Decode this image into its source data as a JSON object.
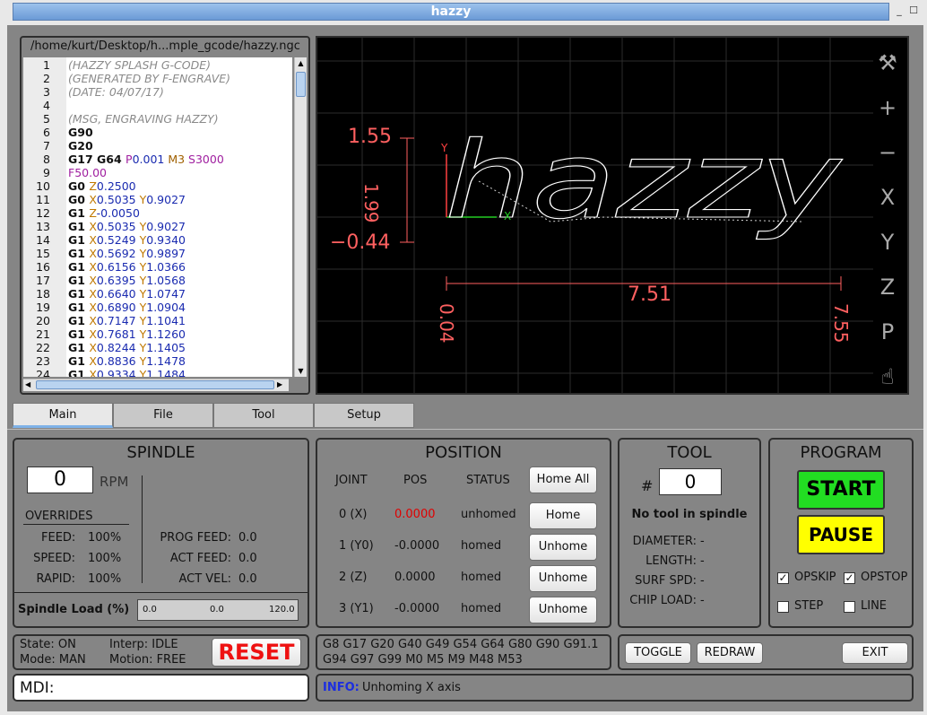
{
  "window": {
    "title": "hazzy"
  },
  "editor": {
    "path": "/home/kurt/Desktop/h...mple_gcode/hazzy.ngc",
    "lines": [
      {
        "n": "1",
        "segs": [
          {
            "t": "(HAZZY SPLASH G-CODE)",
            "c": "c-com"
          }
        ]
      },
      {
        "n": "2",
        "segs": [
          {
            "t": "(GENERATED BY F-ENGRAVE)",
            "c": "c-com"
          }
        ]
      },
      {
        "n": "3",
        "segs": [
          {
            "t": "(DATE: 04/07/17)",
            "c": "c-com"
          }
        ]
      },
      {
        "n": "4",
        "segs": []
      },
      {
        "n": "5",
        "segs": [
          {
            "t": "(MSG, ENGRAVING HAZZY)",
            "c": "c-com"
          }
        ]
      },
      {
        "n": "6",
        "segs": [
          {
            "t": "G90",
            "c": "c-g"
          }
        ]
      },
      {
        "n": "7",
        "segs": [
          {
            "t": "G20",
            "c": "c-g"
          }
        ]
      },
      {
        "n": "8",
        "segs": [
          {
            "t": "G17 G64 ",
            "c": "c-g"
          },
          {
            "t": "P",
            "c": "c-p"
          },
          {
            "t": "0.001 ",
            "c": "c-val"
          },
          {
            "t": "M3 ",
            "c": "c-m"
          },
          {
            "t": "S3000",
            "c": "c-p"
          }
        ]
      },
      {
        "n": "9",
        "segs": [
          {
            "t": "F50.00",
            "c": "c-p"
          }
        ]
      },
      {
        "n": "10",
        "segs": [
          {
            "t": "G0 ",
            "c": "c-g"
          },
          {
            "t": "Z",
            "c": "c-x"
          },
          {
            "t": "0.2500",
            "c": "c-val"
          }
        ]
      },
      {
        "n": "11",
        "segs": [
          {
            "t": "G0 ",
            "c": "c-g"
          },
          {
            "t": "X",
            "c": "c-x"
          },
          {
            "t": "0.5035 ",
            "c": "c-val"
          },
          {
            "t": "Y",
            "c": "c-x"
          },
          {
            "t": "0.9027",
            "c": "c-val"
          }
        ]
      },
      {
        "n": "12",
        "segs": [
          {
            "t": "G1 ",
            "c": "c-g"
          },
          {
            "t": "Z",
            "c": "c-x"
          },
          {
            "t": "-0.0050",
            "c": "c-val"
          }
        ]
      },
      {
        "n": "13",
        "segs": [
          {
            "t": "G1 ",
            "c": "c-g"
          },
          {
            "t": "X",
            "c": "c-x"
          },
          {
            "t": "0.5035 ",
            "c": "c-val"
          },
          {
            "t": "Y",
            "c": "c-x"
          },
          {
            "t": "0.9027",
            "c": "c-val"
          }
        ]
      },
      {
        "n": "14",
        "segs": [
          {
            "t": "G1 ",
            "c": "c-g"
          },
          {
            "t": "X",
            "c": "c-x"
          },
          {
            "t": "0.5249 ",
            "c": "c-val"
          },
          {
            "t": "Y",
            "c": "c-x"
          },
          {
            "t": "0.9340",
            "c": "c-val"
          }
        ]
      },
      {
        "n": "15",
        "segs": [
          {
            "t": "G1 ",
            "c": "c-g"
          },
          {
            "t": "X",
            "c": "c-x"
          },
          {
            "t": "0.5692 ",
            "c": "c-val"
          },
          {
            "t": "Y",
            "c": "c-x"
          },
          {
            "t": "0.9897",
            "c": "c-val"
          }
        ]
      },
      {
        "n": "16",
        "segs": [
          {
            "t": "G1 ",
            "c": "c-g"
          },
          {
            "t": "X",
            "c": "c-x"
          },
          {
            "t": "0.6156 ",
            "c": "c-val"
          },
          {
            "t": "Y",
            "c": "c-x"
          },
          {
            "t": "1.0366",
            "c": "c-val"
          }
        ]
      },
      {
        "n": "17",
        "segs": [
          {
            "t": "G1 ",
            "c": "c-g"
          },
          {
            "t": "X",
            "c": "c-x"
          },
          {
            "t": "0.6395 ",
            "c": "c-val"
          },
          {
            "t": "Y",
            "c": "c-x"
          },
          {
            "t": "1.0568",
            "c": "c-val"
          }
        ]
      },
      {
        "n": "18",
        "segs": [
          {
            "t": "G1 ",
            "c": "c-g"
          },
          {
            "t": "X",
            "c": "c-x"
          },
          {
            "t": "0.6640 ",
            "c": "c-val"
          },
          {
            "t": "Y",
            "c": "c-x"
          },
          {
            "t": "1.0747",
            "c": "c-val"
          }
        ]
      },
      {
        "n": "19",
        "segs": [
          {
            "t": "G1 ",
            "c": "c-g"
          },
          {
            "t": "X",
            "c": "c-x"
          },
          {
            "t": "0.6890 ",
            "c": "c-val"
          },
          {
            "t": "Y",
            "c": "c-x"
          },
          {
            "t": "1.0904",
            "c": "c-val"
          }
        ]
      },
      {
        "n": "20",
        "segs": [
          {
            "t": "G1 ",
            "c": "c-g"
          },
          {
            "t": "X",
            "c": "c-x"
          },
          {
            "t": "0.7147 ",
            "c": "c-val"
          },
          {
            "t": "Y",
            "c": "c-x"
          },
          {
            "t": "1.1041",
            "c": "c-val"
          }
        ]
      },
      {
        "n": "21",
        "segs": [
          {
            "t": "G1 ",
            "c": "c-g"
          },
          {
            "t": "X",
            "c": "c-x"
          },
          {
            "t": "0.7681 ",
            "c": "c-val"
          },
          {
            "t": "Y",
            "c": "c-x"
          },
          {
            "t": "1.1260",
            "c": "c-val"
          }
        ]
      },
      {
        "n": "22",
        "segs": [
          {
            "t": "G1 ",
            "c": "c-g"
          },
          {
            "t": "X",
            "c": "c-x"
          },
          {
            "t": "0.8244 ",
            "c": "c-val"
          },
          {
            "t": "Y",
            "c": "c-x"
          },
          {
            "t": "1.1405",
            "c": "c-val"
          }
        ]
      },
      {
        "n": "23",
        "segs": [
          {
            "t": "G1 ",
            "c": "c-g"
          },
          {
            "t": "X",
            "c": "c-x"
          },
          {
            "t": "0.8836 ",
            "c": "c-val"
          },
          {
            "t": "Y",
            "c": "c-x"
          },
          {
            "t": "1.1478",
            "c": "c-val"
          }
        ]
      },
      {
        "n": "24",
        "segs": [
          {
            "t": "G1 ",
            "c": "c-g"
          },
          {
            "t": "X",
            "c": "c-x"
          },
          {
            "t": "0.9334 ",
            "c": "c-val"
          },
          {
            "t": "Y",
            "c": "c-x"
          },
          {
            "t": "1.1484",
            "c": "c-val"
          }
        ]
      }
    ]
  },
  "preview": {
    "text": "hazzy",
    "dims": {
      "y_top": "1.55",
      "y_height": "1.99",
      "y_bottom": "−0.44",
      "x_width": "7.51",
      "x_left": "0.04",
      "x_right": "7.55"
    },
    "axis_x": "X",
    "axis_y": "Y",
    "tools": [
      {
        "name": "settings-tools-icon",
        "glyph": "⚒"
      },
      {
        "name": "zoom-in-icon",
        "glyph": "+"
      },
      {
        "name": "zoom-out-icon",
        "glyph": "−"
      },
      {
        "name": "view-x-icon",
        "glyph": "X"
      },
      {
        "name": "view-y-icon",
        "glyph": "Y"
      },
      {
        "name": "view-z-icon",
        "glyph": "Z"
      },
      {
        "name": "view-p-icon",
        "glyph": "P"
      },
      {
        "name": "pan-hand-icon",
        "glyph": "☝"
      }
    ]
  },
  "tabs": [
    "Main",
    "File",
    "Tool",
    "Setup"
  ],
  "spindle": {
    "title": "SPINDLE",
    "rpm_value": "0",
    "rpm_unit": "RPM",
    "overrides_label": "OVERRIDES",
    "overrides": [
      {
        "label": "FEED:",
        "value": "100%"
      },
      {
        "label": "SPEED:",
        "value": "100%"
      },
      {
        "label": "RAPID:",
        "value": "100%"
      }
    ],
    "feeds": [
      {
        "label": "PROG FEED:",
        "value": "0.0"
      },
      {
        "label": "ACT FEED:",
        "value": "0.0"
      },
      {
        "label": "ACT VEL:",
        "value": "0.0"
      }
    ],
    "load_label": "Spindle Load (%)",
    "load_min": "0.0",
    "load_mid": "0.0",
    "load_max": "120.0",
    "load_fraction": 0
  },
  "position": {
    "title": "POSITION",
    "headers": [
      "JOINT",
      "POS",
      "STATUS"
    ],
    "home_all": "Home All",
    "rows": [
      {
        "joint": "0 (X)",
        "pos": "0.0000",
        "status": "unhomed",
        "button": "Home",
        "pos_color": "#e00000"
      },
      {
        "joint": "1 (Y0)",
        "pos": "-0.0000",
        "status": "homed",
        "button": "Unhome",
        "pos_color": "#111111"
      },
      {
        "joint": "2 (Z)",
        "pos": "0.0000",
        "status": "homed",
        "button": "Unhome",
        "pos_color": "#111111"
      },
      {
        "joint": "3 (Y1)",
        "pos": "-0.0000",
        "status": "homed",
        "button": "Unhome",
        "pos_color": "#111111"
      }
    ]
  },
  "tool": {
    "title": "TOOL",
    "hash": "#",
    "number": "0",
    "status": "No tool in spindle",
    "fields": [
      {
        "label": "DIAMETER:",
        "value": "-"
      },
      {
        "label": "LENGTH:",
        "value": "-"
      },
      {
        "label": "SURF SPD:",
        "value": "-"
      },
      {
        "label": "CHIP LOAD:",
        "value": "-"
      }
    ]
  },
  "program": {
    "title": "PROGRAM",
    "start": "START",
    "pause": "PAUSE",
    "start_color": "#22dd22",
    "pause_color": "#ffff00",
    "checks": [
      {
        "label": "OPSKIP",
        "checked": "✓"
      },
      {
        "label": "OPSTOP",
        "checked": "✓"
      },
      {
        "label": "STEP",
        "checked": ""
      },
      {
        "label": "LINE",
        "checked": ""
      }
    ]
  },
  "status": {
    "state": "State: ON",
    "mode": "Mode: MAN",
    "interp": "Interp: IDLE",
    "motion": "Motion: FREE",
    "reset": "RESET"
  },
  "gcodes": {
    "line1": "G8 G17 G20 G40 G49 G54 G64 G80 G90 G91.1",
    "line2": "G94 G97 G99 M0 M5 M9 M48 M53"
  },
  "actions": {
    "toggle": "TOGGLE",
    "redraw": "REDRAW",
    "exit": "EXIT"
  },
  "mdi": {
    "label": "MDI:"
  },
  "message": {
    "tag": "INFO:",
    "text": "Unhoming X axis"
  }
}
